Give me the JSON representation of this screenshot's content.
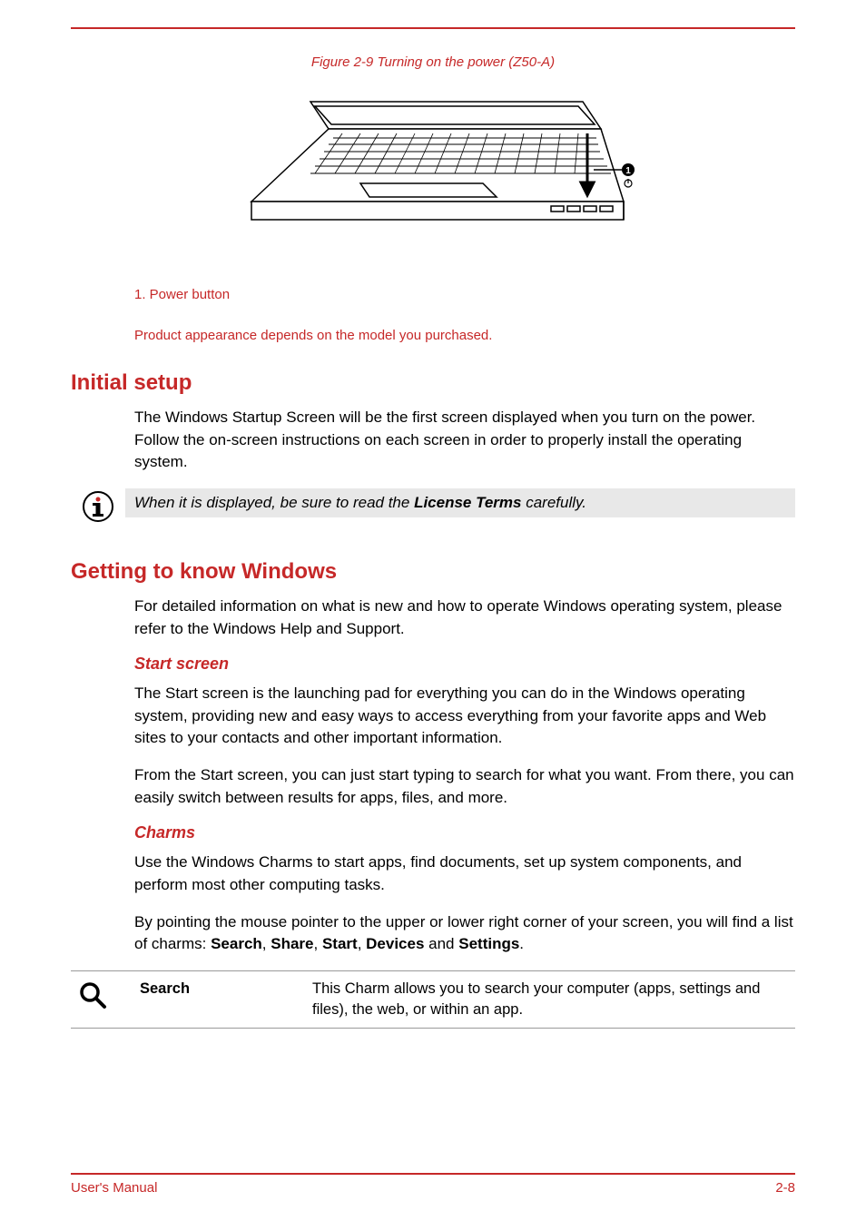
{
  "figure": {
    "caption": "Figure 2-9 Turning on the power (Z50-A)",
    "callout_number": "1",
    "legend_item": "1. Power button",
    "product_note": "Product appearance depends on the model you purchased."
  },
  "section_initial_setup": {
    "heading": "Initial setup",
    "paragraph": "The Windows Startup Screen will be the first screen displayed when you turn on the power. Follow the on-screen instructions on each screen in order to properly install the operating system.",
    "note_prefix": "When it is displayed, be sure to read the ",
    "note_bold": "License Terms",
    "note_suffix": " carefully."
  },
  "section_windows": {
    "heading": "Getting to know Windows",
    "paragraph": "For detailed information on what is new and how to operate Windows operating system, please refer to the Windows Help and Support."
  },
  "section_start_screen": {
    "heading": "Start screen",
    "p1": "The Start screen is the launching pad for everything you can do in the Windows operating system, providing new and easy ways to access everything from your favorite apps and Web sites to your contacts and other important information.",
    "p2": "From the Start screen, you can just start typing to search for what you want. From there, you can easily switch between results for apps, files, and more."
  },
  "section_charms": {
    "heading": "Charms",
    "p1": "Use the Windows Charms to start apps, find documents, set up system components, and perform most other computing tasks.",
    "p2_prefix": "By pointing the mouse pointer to the upper or lower right corner of your screen, you will find a list of charms: ",
    "charm_names": {
      "search": "Search",
      "share": "Share",
      "start": "Start",
      "devices": "Devices",
      "settings": "Settings"
    },
    "p2_and": " and ",
    "p2_comma": ", ",
    "p2_suffix": ".",
    "table": {
      "search_name": "Search",
      "search_desc": "This Charm allows you to search your computer (apps, settings and files), the web, or within an app."
    }
  },
  "footer": {
    "left": "User's Manual",
    "right": "2-8"
  }
}
